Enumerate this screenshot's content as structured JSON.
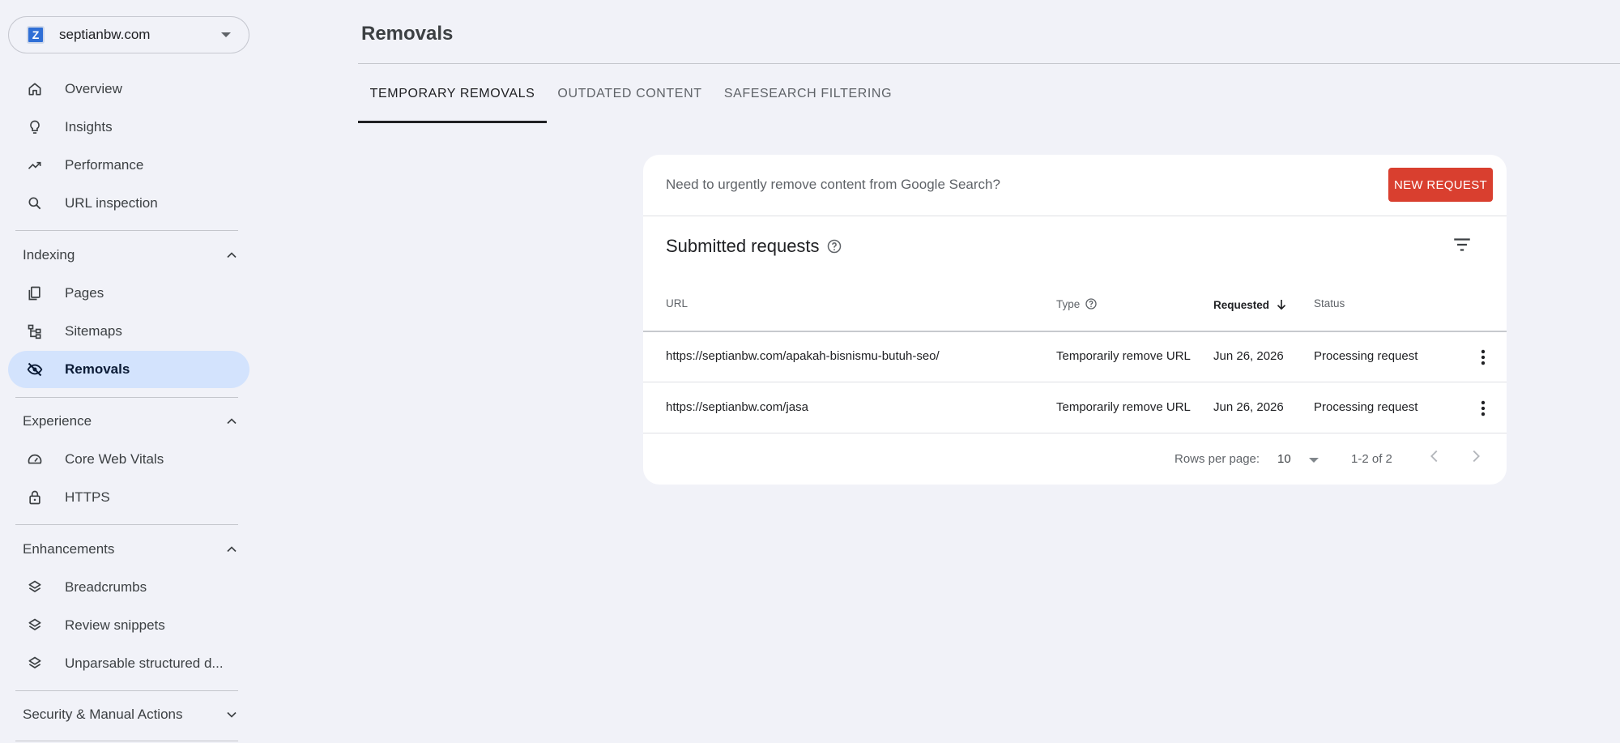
{
  "property": {
    "name": "septianbw.com",
    "favicon_letter": "Z"
  },
  "sidebar": {
    "items": [
      {
        "label": "Overview",
        "icon": "home-icon"
      },
      {
        "label": "Insights",
        "icon": "lightbulb-icon"
      },
      {
        "label": "Performance",
        "icon": "trending-up-icon"
      },
      {
        "label": "URL inspection",
        "icon": "search-icon"
      }
    ],
    "sections": [
      {
        "label": "Indexing",
        "expanded": true,
        "items": [
          {
            "label": "Pages",
            "icon": "pages-icon"
          },
          {
            "label": "Sitemaps",
            "icon": "sitemap-icon"
          },
          {
            "label": "Removals",
            "icon": "visibility-off-icon",
            "active": true
          }
        ]
      },
      {
        "label": "Experience",
        "expanded": true,
        "items": [
          {
            "label": "Core Web Vitals",
            "icon": "speedometer-icon"
          },
          {
            "label": "HTTPS",
            "icon": "lock-icon"
          }
        ]
      },
      {
        "label": "Enhancements",
        "expanded": true,
        "items": [
          {
            "label": "Breadcrumbs",
            "icon": "layers-icon"
          },
          {
            "label": "Review snippets",
            "icon": "layers-icon"
          },
          {
            "label": "Unparsable structured d...",
            "icon": "layers-icon"
          }
        ]
      },
      {
        "label": "Security & Manual Actions",
        "expanded": false,
        "items": []
      }
    ]
  },
  "page": {
    "title": "Removals"
  },
  "tabs": [
    {
      "label": "TEMPORARY REMOVALS",
      "active": true
    },
    {
      "label": "OUTDATED CONTENT",
      "active": false
    },
    {
      "label": "SAFESEARCH FILTERING",
      "active": false
    }
  ],
  "card": {
    "urgent_text": "Need to urgently remove content from Google Search?",
    "new_request_label": "NEW REQUEST",
    "submitted_title": "Submitted requests",
    "columns": {
      "url": "URL",
      "type": "Type",
      "requested": "Requested",
      "status": "Status"
    },
    "rows": [
      {
        "url": "https://septianbw.com/apakah-bisnismu-butuh-seo/",
        "type": "Temporarily remove URL",
        "requested": "Jun 26, 2026",
        "status": "Processing request"
      },
      {
        "url": "https://septianbw.com/jasa",
        "type": "Temporarily remove URL",
        "requested": "Jun 26, 2026",
        "status": "Processing request"
      }
    ],
    "pagination": {
      "rows_per_page_label": "Rows per page:",
      "rows_per_page": "10",
      "range": "1-2 of 2"
    }
  },
  "colors": {
    "accent_red": "#d93f2f",
    "active_nav": "#d3e3fd",
    "background": "#f1f2f8"
  }
}
